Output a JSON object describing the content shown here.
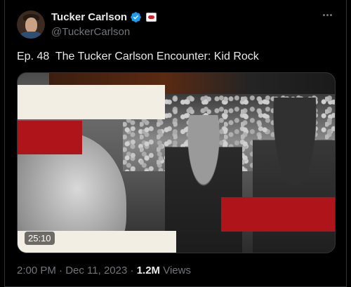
{
  "author": {
    "display_name": "Tucker Carlson",
    "handle": "@TuckerCarlson",
    "verified_color": "#1d9bf0",
    "avatar_icon": "profile-photo"
  },
  "post": {
    "text": "Ep. 48  The Tucker Carlson Encounter: Kid Rock"
  },
  "media": {
    "duration": "25:10",
    "accent_red": "#b0141b",
    "accent_cream": "#f3eee3"
  },
  "meta": {
    "time": "2:00 PM",
    "separator1": " · ",
    "date": "Dec 11, 2023",
    "separator2": " · ",
    "views_count": "1.2M",
    "views_label": " Views"
  }
}
